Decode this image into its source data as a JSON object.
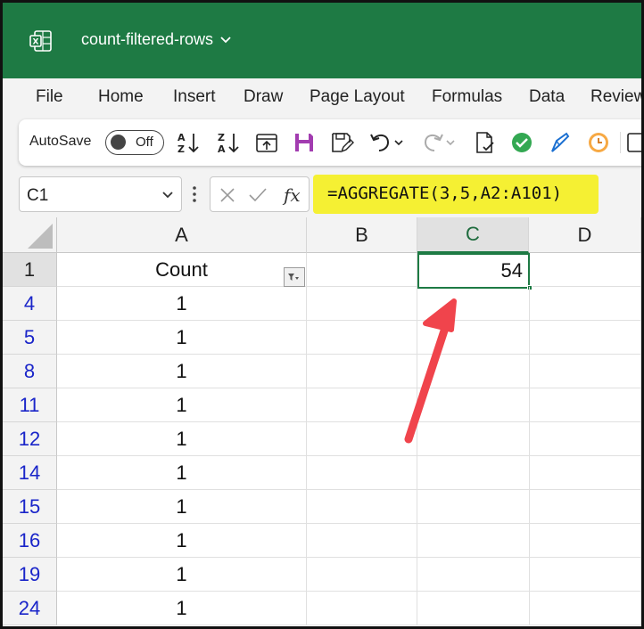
{
  "window": {
    "title": "count-filtered-rows",
    "colors": {
      "titlebar": "#1e7a44",
      "accent": "#1e7a44",
      "highlight": "#f5f033",
      "annotation_arrow": "#f0444c",
      "row_numbers": "#1a25c9"
    }
  },
  "menu": [
    "File",
    "Home",
    "Insert",
    "Draw",
    "Page Layout",
    "Formulas",
    "Data",
    "Review"
  ],
  "toolbar": {
    "autosave_label": "AutoSave",
    "autosave_state": "Off",
    "icons": [
      "sort-ascending-icon",
      "sort-descending-icon",
      "refresh-icon",
      "save-icon",
      "save-as-icon",
      "undo-icon",
      "redo-icon",
      "document-check-icon",
      "check-circle-icon",
      "pen-icon",
      "clock-icon"
    ]
  },
  "formula_bar": {
    "name_box": "C1",
    "formula": "=AGGREGATE(3,5,A2:A101)"
  },
  "sheet": {
    "columns": [
      "A",
      "B",
      "C",
      "D"
    ],
    "selected_column": "C",
    "header_row": {
      "row_number": "1",
      "A": "Count",
      "C": "54"
    },
    "rows": [
      {
        "row_number": "4",
        "A": "1"
      },
      {
        "row_number": "5",
        "A": "1"
      },
      {
        "row_number": "8",
        "A": "1"
      },
      {
        "row_number": "11",
        "A": "1"
      },
      {
        "row_number": "12",
        "A": "1"
      },
      {
        "row_number": "14",
        "A": "1"
      },
      {
        "row_number": "15",
        "A": "1"
      },
      {
        "row_number": "16",
        "A": "1"
      },
      {
        "row_number": "19",
        "A": "1"
      },
      {
        "row_number": "24",
        "A": "1"
      }
    ]
  }
}
